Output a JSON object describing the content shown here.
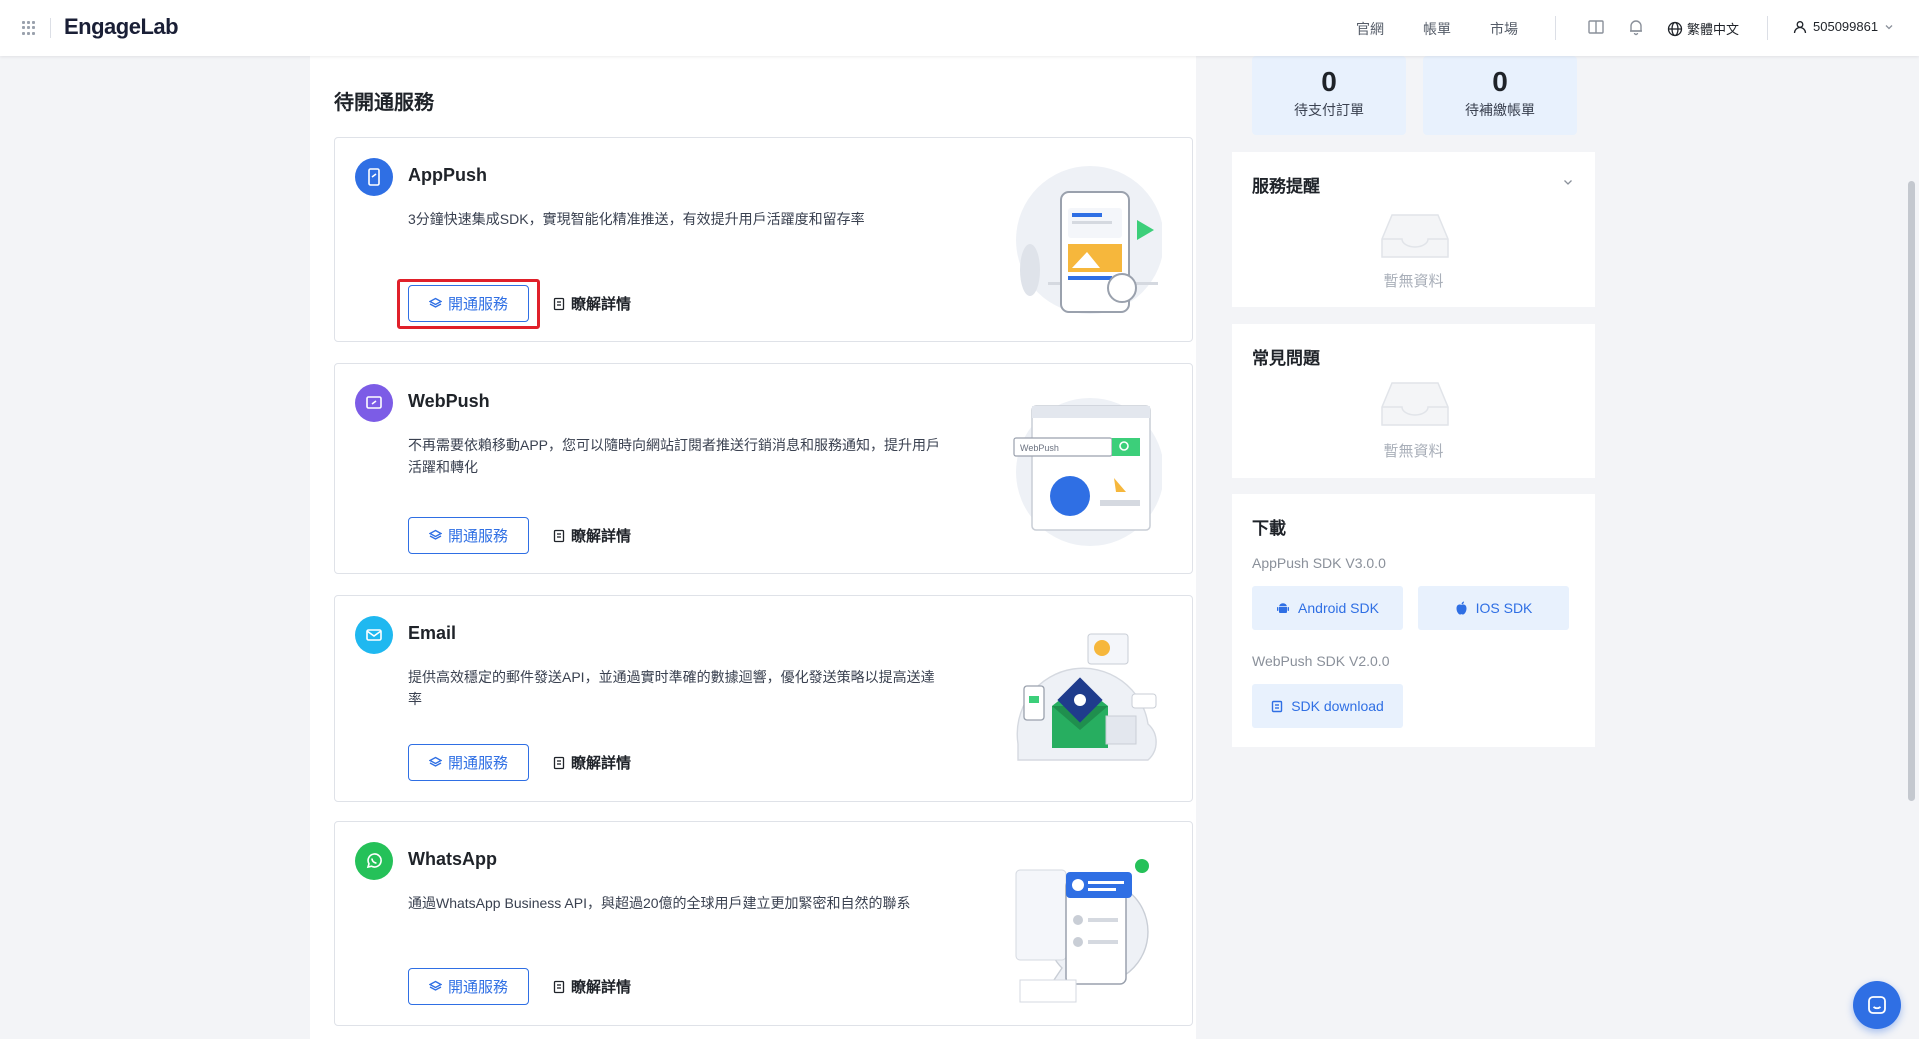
{
  "header": {
    "logo": "EngageLab",
    "nav": [
      "官網",
      "帳單",
      "市場"
    ],
    "language": "繁體中文",
    "user_id": "505099861"
  },
  "main": {
    "section_title": "待開通服務",
    "open_label": "開通服務",
    "detail_label": "瞭解詳情",
    "services": [
      {
        "name": "AppPush",
        "desc": "3分鐘快速集成SDK，實現智能化精准推送，有效提升用戶活躍度和留存率",
        "icon": "phone-push-icon",
        "color": "#2f6fe4"
      },
      {
        "name": "WebPush",
        "desc": "不再需要依賴移動APP，您可以隨時向網站訂閱者推送行銷消息和服務通知，提升用戶活躍和轉化",
        "icon": "web-push-icon",
        "color": "#7c5ce6",
        "illus_text": "WebPush"
      },
      {
        "name": "Email",
        "desc": "提供高效穩定的郵件發送API，並通過實时準確的數據迴響，優化發送策略以提高送達率",
        "icon": "mail-icon",
        "color": "#1fb8f0"
      },
      {
        "name": "WhatsApp",
        "desc": "通過WhatsApp Business API，與超過20億的全球用戶建立更加緊密和自然的聯系",
        "icon": "whatsapp-icon",
        "color": "#25c159"
      }
    ]
  },
  "stats": [
    {
      "value": "0",
      "label": "待支付訂單"
    },
    {
      "value": "0",
      "label": "待補繳帳單"
    }
  ],
  "reminders": {
    "title": "服務提醒",
    "empty": "暫無資料"
  },
  "faq": {
    "title": "常見問題",
    "empty": "暫無資料"
  },
  "downloads": {
    "title": "下載",
    "apppush_version": "AppPush SDK V3.0.0",
    "android_label": "Android SDK",
    "ios_label": "IOS SDK",
    "webpush_version": "WebPush SDK V2.0.0",
    "sdk_download_label": "SDK download"
  }
}
